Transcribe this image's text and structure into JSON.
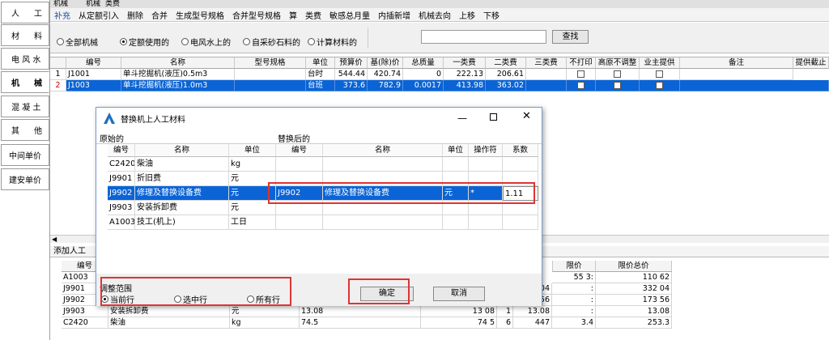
{
  "sidebar": {
    "items": [
      {
        "a": "人",
        "b": "工"
      },
      {
        "a": "材",
        "b": "料"
      },
      {
        "a": "电 风 水",
        "b": ""
      },
      {
        "a": "机",
        "b": "械"
      },
      {
        "a": "混 凝 土",
        "b": ""
      },
      {
        "a": "其",
        "b": "他"
      },
      {
        "a": "中间单价",
        "b": ""
      },
      {
        "a": "建安单价",
        "b": ""
      }
    ]
  },
  "tabs": [
    "机械",
    "机械",
    "类费"
  ],
  "toolbar": [
    "补充",
    "从定额引入",
    "删除",
    "合并",
    "生成型号规格",
    "合并型号规格",
    "算",
    "类费",
    "敏感总月量",
    "内插新增",
    "机械去向",
    "上移",
    "下移"
  ],
  "filters": [
    "全部机械",
    "定额使用的",
    "电风水上的",
    "自采砂石料的",
    "计算材料的"
  ],
  "search": {
    "placeholder": "",
    "button": "查找"
  },
  "grid": {
    "headers": [
      "编号",
      "名称",
      "型号规格",
      "单位",
      "预算价",
      "基(除)价",
      "总质量",
      "一类费",
      "二类费",
      "三类费",
      "不打印",
      "高原不调整",
      "业主提供",
      "备注",
      "提供截止"
    ],
    "rows": [
      {
        "n": "1",
        "code": "J1001",
        "name": "单斗挖掘机(液压)0.5m3",
        "spec": "",
        "unit": "台时",
        "budget": "544.44",
        "base": "420.74",
        "weight": "0",
        "c1": "222.13",
        "c2": "206.61",
        "c3": ""
      },
      {
        "n": "2",
        "code": "J1003",
        "name": "单斗挖掘机(液压)1.0m3",
        "spec": "",
        "unit": "台班",
        "budget": "373.6",
        "base": "782.9",
        "weight": "0.0017",
        "c1": "413.98",
        "c2": "363.02",
        "c3": ""
      }
    ]
  },
  "bottom_tab": "添加人工",
  "bottom_grid": {
    "headers": [
      "编号",
      "限价",
      "限价总价"
    ],
    "rows": [
      {
        "code": "A1003",
        "name": "",
        "unit": "",
        "v1": "",
        "v2": "",
        "v3": "",
        "v4": "",
        "limit": "55 3:",
        "total": "110 62"
      },
      {
        "code": "J9901",
        "name": "",
        "unit": "",
        "v1": "",
        "v2": "",
        "v3": "04",
        "v4": "",
        "limit": ":",
        "total": "332 04"
      },
      {
        "code": "J9902",
        "name": "",
        "unit": "",
        "v1": "",
        "v2": "",
        "v3": "56",
        "v4": "",
        "limit": ":",
        "total": "173 56"
      },
      {
        "code": "J9903",
        "name": "安装拆卸费",
        "unit": "元",
        "v1": "13.08",
        "v2": "13 08",
        "v3": "1",
        "v4": "13.08",
        "limit": ":",
        "total": "13.08"
      },
      {
        "code": "C2420",
        "name": "柴油",
        "unit": "kg",
        "v1": "74.5",
        "v2": "74 5",
        "v3": "6",
        "v4": "447",
        "limit": "3.4",
        "total": "253.3"
      }
    ]
  },
  "dialog": {
    "title": "替换机上人工材料",
    "before_label": "原始的",
    "after_label": "替换后的",
    "headers_left": [
      "编号",
      "名称",
      "单位"
    ],
    "headers_right": [
      "编号",
      "名称",
      "单位",
      "操作符",
      "系数"
    ],
    "rows": [
      {
        "code": "C2420",
        "name": "柴油",
        "unit": "kg",
        "rcode": "",
        "rname": "",
        "runit": "",
        "op": "",
        "coef": ""
      },
      {
        "code": "J9901",
        "name": "折旧费",
        "unit": "元",
        "rcode": "",
        "rname": "",
        "runit": "",
        "op": "",
        "coef": ""
      },
      {
        "code": "J9902",
        "name": "修理及替换设备费",
        "unit": "元",
        "rcode": "J9902",
        "rname": "修理及替换设备费",
        "runit": "元",
        "op": "*",
        "coef": "1.11"
      },
      {
        "code": "J9903",
        "name": "安装拆卸费",
        "unit": "元",
        "rcode": "",
        "rname": "",
        "runit": "",
        "op": "",
        "coef": ""
      },
      {
        "code": "A1003",
        "name": "技工(机上)",
        "unit": "工日",
        "rcode": "",
        "rname": "",
        "runit": "",
        "op": "",
        "coef": ""
      }
    ],
    "scope_label": "调整范围",
    "scope_options": [
      "当前行",
      "选中行",
      "所有行"
    ],
    "ok": "确定",
    "cancel": "取消"
  }
}
